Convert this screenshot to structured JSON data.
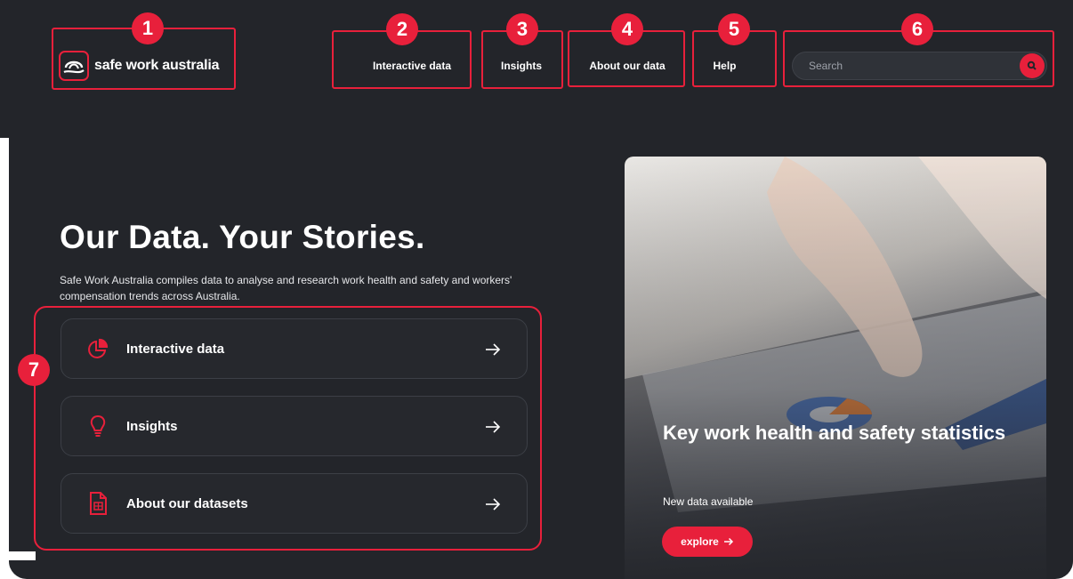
{
  "header": {
    "logo_text": "safe work australia",
    "nav": [
      {
        "label": "Interactive data"
      },
      {
        "label": "Insights"
      },
      {
        "label": "About our data"
      },
      {
        "label": "Help"
      }
    ],
    "search": {
      "placeholder": "Search"
    }
  },
  "hero": {
    "title": "Our Data. Your Stories.",
    "description": "Safe Work Australia compiles data to analyse and research work health and safety and workers' compensation trends across Australia."
  },
  "cards": [
    {
      "label": "Interactive data",
      "icon": "pie-chart-icon"
    },
    {
      "label": "Insights",
      "icon": "lightbulb-icon"
    },
    {
      "label": "About our datasets",
      "icon": "spreadsheet-file-icon"
    }
  ],
  "promo": {
    "title": "Key work health and safety statistics",
    "subtitle": "New data available",
    "button": "explore"
  },
  "annotations": [
    "1",
    "2",
    "3",
    "4",
    "5",
    "6",
    "7"
  ],
  "colors": {
    "background": "#23252a",
    "accent": "#e8203b",
    "text": "#ffffff"
  }
}
